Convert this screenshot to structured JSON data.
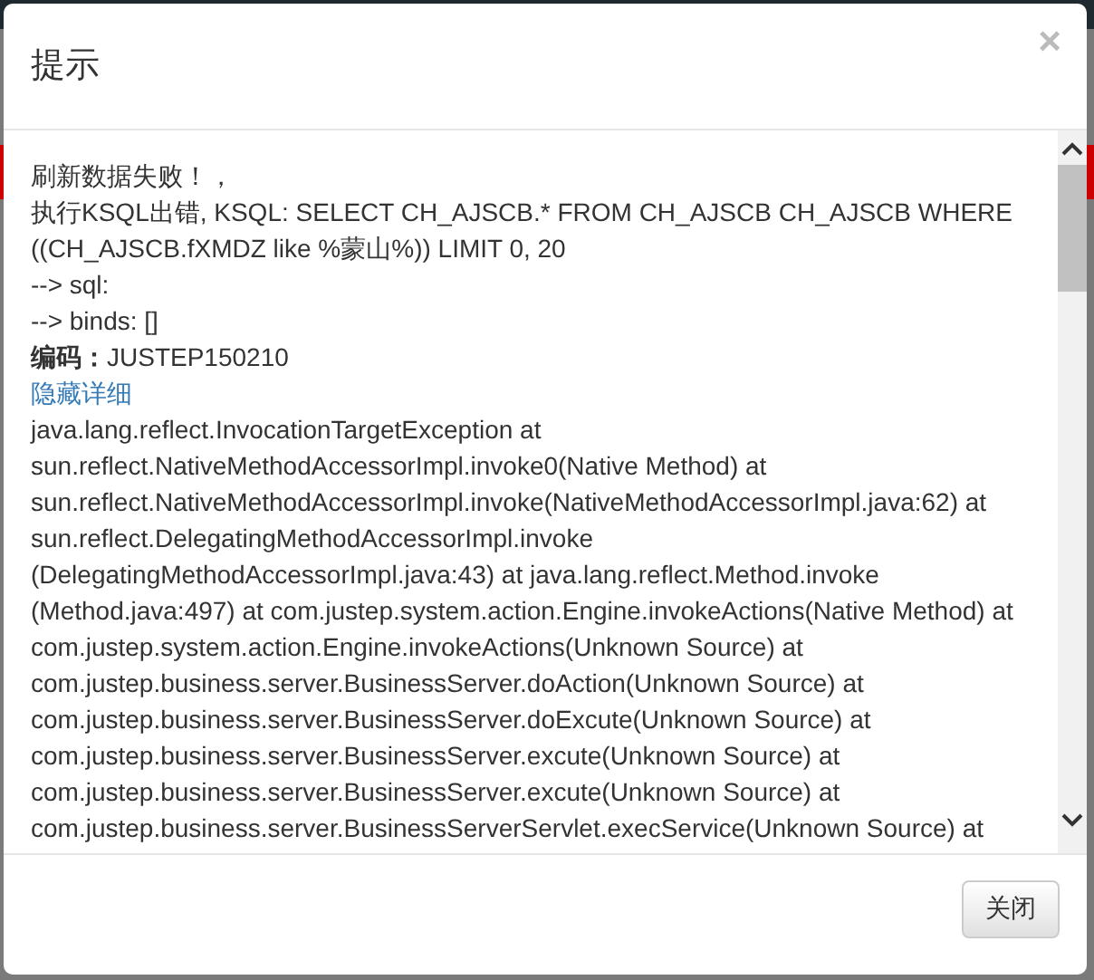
{
  "dialog": {
    "title": "提示",
    "close": "×"
  },
  "message": {
    "lines": [
      "刷新数据失败！，",
      "执行KSQL出错, KSQL: SELECT CH_AJSCB.* FROM CH_AJSCB CH_AJSCB WHERE",
      "((CH_AJSCB.fXMDZ like %蒙山%)) LIMIT 0, 20",
      "--> sql:",
      "--> binds: []",
      "**编码：**JUSTEP150210"
    ],
    "toggle_link": "隐藏详细",
    "details": [
      "java.lang.reflect.InvocationTargetException at",
      "sun.reflect.NativeMethodAccessorImpl.invoke0(Native Method) at",
      "sun.reflect.NativeMethodAccessorImpl.invoke(NativeMethodAccessorImpl.java:62) at",
      "sun.reflect.DelegatingMethodAccessorImpl.invoke",
      "(DelegatingMethodAccessorImpl.java:43) at java.lang.reflect.Method.invoke",
      "(Method.java:497) at com.justep.system.action.Engine.invokeActions(Native Method) at",
      "com.justep.system.action.Engine.invokeActions(Unknown Source) at",
      "com.justep.business.server.BusinessServer.doAction(Unknown Source) at",
      "com.justep.business.server.BusinessServer.doExcute(Unknown Source) at",
      "com.justep.business.server.BusinessServer.excute(Unknown Source) at",
      "com.justep.business.server.BusinessServer.excute(Unknown Source) at",
      "com.justep.business.server.BusinessServerServlet.execService(Unknown Source) at"
    ]
  },
  "buttons": [
    "关闭"
  ]
}
